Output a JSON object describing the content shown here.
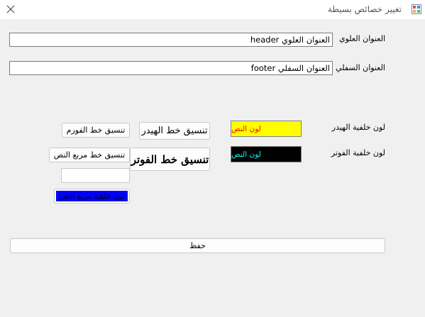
{
  "window": {
    "title": "تغيير خصائص بسيطة",
    "close_glyph": "✕"
  },
  "header": {
    "label": "العنوان العلوي",
    "value": "العنوان العلوي header"
  },
  "footer": {
    "label": "العنوان السفلي",
    "value": "العنوان السفلي footer"
  },
  "header_background": {
    "label": "لون خلفية الهيدر",
    "text": "لون النص",
    "background": "#ffff00",
    "text_color": "#ff0000"
  },
  "footer_background": {
    "label": "لون خلفية الفوتر",
    "text": "لون النص",
    "background": "#000000",
    "text_color": "#00ffff"
  },
  "buttons": {
    "header_font": "تنسيق خط الهيدر",
    "footer_font": "تنسيق خط الفوتر",
    "form_font": "تنسيق خط الفورم",
    "textbox_font": "تنسيق خط مربع النص",
    "textbox_bg": "لون خلفية مربع النص",
    "save": "حفظ"
  },
  "colors": {
    "textbox_bg_button": "#0000ff",
    "textbox_bg_text": "#000000"
  },
  "sample_textbox": {
    "value": ""
  }
}
